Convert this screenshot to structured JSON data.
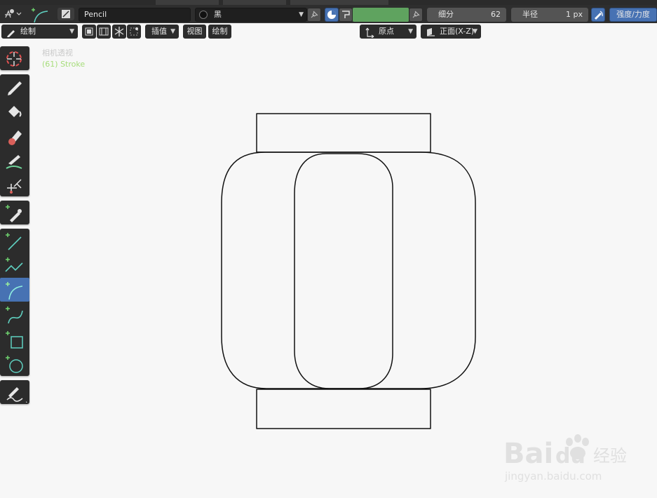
{
  "header": {
    "brush_name": "Pencil",
    "material_name": "黑",
    "subdivision": {
      "label": "细分",
      "value": "62"
    },
    "radius": {
      "label": "半径",
      "value": "1 px"
    },
    "strength_button": "强度/力度",
    "vertex_color": "#5fa35f"
  },
  "toolbar2": {
    "mode": "绘制",
    "interpolate": "插值",
    "view_menu": "视图",
    "draw_menu": "绘制",
    "pivot": "原点",
    "orientation": "正面(X-Z)"
  },
  "viewport": {
    "camera_label": "相机透视",
    "object_label": "(61) Stroke",
    "background": "#f7f7f7"
  },
  "tools": [
    "cursor",
    "draw",
    "fill",
    "erase",
    "tint",
    "cutter",
    "eyedropper",
    "line",
    "polyline",
    "arc",
    "curve",
    "box",
    "circle",
    "annotate"
  ],
  "active_tool": "arc",
  "watermark": {
    "brand": "Bai",
    "brand2": "du",
    "brand_cn": "经验",
    "url": "jingyan.baidu.com"
  }
}
